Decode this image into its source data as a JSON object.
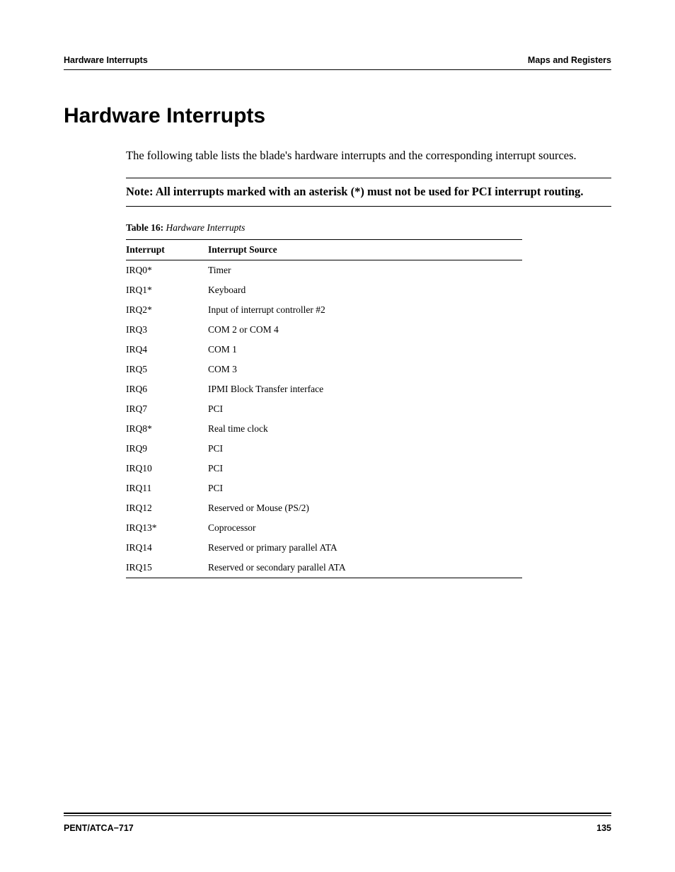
{
  "header": {
    "left": "Hardware Interrupts",
    "right": "Maps and Registers"
  },
  "title": "Hardware Interrupts",
  "intro": "The following table lists the blade's hardware interrupts and the corresponding interrupt sources.",
  "note": "Note:  All interrupts marked with an asterisk (*) must not be used for PCI interrupt routing.",
  "table": {
    "caption_label": "Table 16:",
    "caption_title": " Hardware Interrupts",
    "headers": {
      "col1": "Interrupt",
      "col2": "Interrupt Source"
    },
    "rows": [
      {
        "c1": "IRQ0*",
        "c2": "Timer"
      },
      {
        "c1": "IRQ1*",
        "c2": "Keyboard"
      },
      {
        "c1": "IRQ2*",
        "c2": "Input of interrupt controller #2"
      },
      {
        "c1": "IRQ3",
        "c2": "COM 2 or COM 4"
      },
      {
        "c1": "IRQ4",
        "c2": "COM 1"
      },
      {
        "c1": "IRQ5",
        "c2": "COM 3"
      },
      {
        "c1": "IRQ6",
        "c2": "IPMI Block Transfer interface"
      },
      {
        "c1": "IRQ7",
        "c2": "PCI"
      },
      {
        "c1": "IRQ8*",
        "c2": "Real time clock"
      },
      {
        "c1": "IRQ9",
        "c2": "PCI"
      },
      {
        "c1": "IRQ10",
        "c2": "PCI"
      },
      {
        "c1": "IRQ11",
        "c2": "PCI"
      },
      {
        "c1": "IRQ12",
        "c2": "Reserved or Mouse (PS/2)"
      },
      {
        "c1": "IRQ13*",
        "c2": "Coprocessor"
      },
      {
        "c1": "IRQ14",
        "c2": "Reserved or primary parallel ATA"
      },
      {
        "c1": "IRQ15",
        "c2": "Reserved or secondary parallel ATA"
      }
    ]
  },
  "footer": {
    "left": "PENT/ATCA−717",
    "right": "135"
  }
}
